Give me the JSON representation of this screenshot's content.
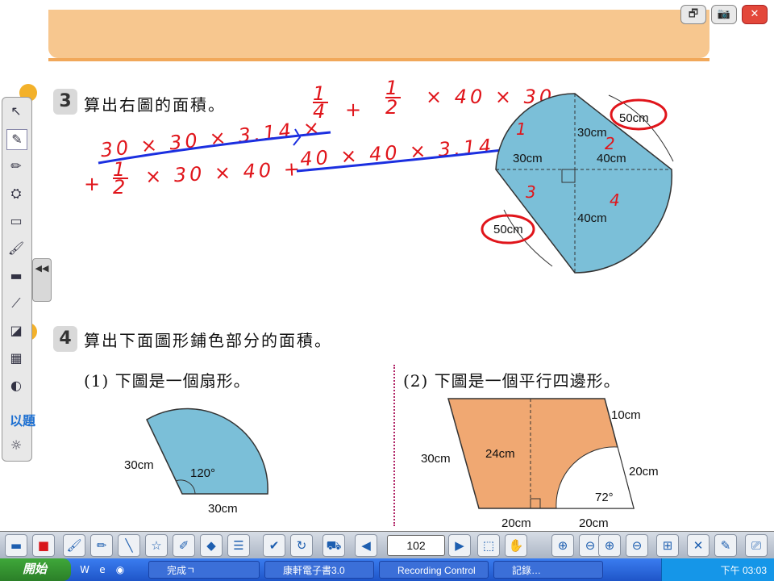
{
  "top_buttons": {
    "restore": "🗗",
    "camera": "📷",
    "close": "✕"
  },
  "question3": {
    "number": "3",
    "text": "算出右圖的面積。",
    "work_line1": "30 × 30 × 3.14 × 1/4 + 1/2 × 40 × 30",
    "work_line2": "+ 1/2 × 30 × 40 + 40 × 40 × 3.14 × 1/4",
    "frac_num": "1",
    "frac_den": "4",
    "plus": "+",
    "frac2_num": "1",
    "frac2_den": "2",
    "times_40_30": "× 40 × 30",
    "line1_main": "30 × 30 × 3.14 ×",
    "line2_plus": "+",
    "line2_frac_num": "1",
    "line2_frac_den": "2",
    "line2_main": "× 30 × 40 +",
    "line2_tail": "40 × 40 × 3.14 ×",
    "figure": {
      "top_label": "30cm",
      "left_label": "30cm",
      "right_label": "40cm",
      "bottom_label": "40cm",
      "label_50a": "50cm",
      "label_50b": "50cm",
      "marks": {
        "m1": "1",
        "m2": "2",
        "m3": "3",
        "m4": "4"
      }
    }
  },
  "question4": {
    "number": "4",
    "text": "算出下面圖形鋪色部分的面積。",
    "part1": {
      "text": "(1) 下圖是一個扇形。",
      "side": "30cm",
      "base": "30cm",
      "angle": "120°"
    },
    "part2": {
      "text": "(2) 下圖是一個平行四邊形。",
      "height": "24cm",
      "left": "30cm",
      "top_right": "10cm",
      "right": "20cm",
      "angle": "72°",
      "bottom_left": "20cm",
      "bottom_right": "20cm"
    }
  },
  "left_toolbar": {
    "tools": [
      "↖",
      "✎",
      "✏",
      "⛭",
      "▭",
      "🖌",
      "▬",
      "⟋",
      "◪",
      "▦",
      "◐",
      "☼"
    ],
    "collapse": "◀◀",
    "brand": "以題"
  },
  "bottom_toolbar": {
    "page": "102",
    "tools_left": [
      "▬",
      "■",
      "🖌",
      "✏",
      "╲",
      "☆",
      "✐",
      "◆",
      "☰",
      "✔",
      "↻",
      "⛟",
      "◀"
    ],
    "tools_right": [
      "▶",
      "⬚",
      "✋",
      "⊕",
      "⊖",
      "⊕",
      "⊖",
      "⊞",
      "✕",
      "✎",
      "⎚"
    ]
  },
  "taskbar": {
    "start": "開始",
    "items": [
      "完成ㄱ",
      "康軒電子書3.0",
      "Recording Control",
      "記錄…"
    ],
    "clock": "下午 03:03"
  },
  "colors": {
    "accent": "#f1a85a",
    "fill_blue": "#7bbfd8",
    "fill_orange": "#f0a872",
    "ink_red": "#e0151b",
    "ink_blue": "#1b2fe0"
  }
}
